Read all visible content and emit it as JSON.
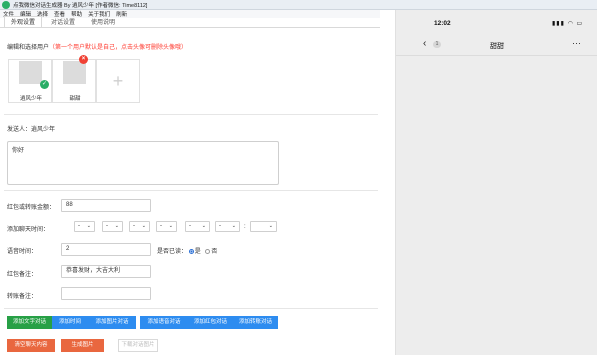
{
  "window": {
    "title": "点我微信对话生成器 By 逍风少年 [作者微信: Time8112]"
  },
  "menu": {
    "items": [
      "文件",
      "编辑",
      "选择",
      "查看",
      "帮助",
      "关于我们",
      "刷新"
    ]
  },
  "tabs": [
    {
      "label": "外观设置",
      "active": true
    },
    {
      "label": "对话设置",
      "active": false
    },
    {
      "label": "使用说明",
      "active": false
    }
  ],
  "users": {
    "hint_prefix": "编辑和选择用户",
    "hint_note": "（第一个用户默认是自己，点击头像可删除头像哦）",
    "list": [
      {
        "name": "逍风少年",
        "badge": "✓"
      },
      {
        "name": "甜甜",
        "badge": "×"
      }
    ],
    "add_symbol": "+"
  },
  "compose": {
    "sender_label": "发送人：逍风少年",
    "message_value": "你好",
    "amount_label": "红包或转账金额：",
    "amount_value": "88",
    "time_label": "添加聊天时间：",
    "time_selects": [
      "-",
      "-",
      "-",
      "-",
      "-",
      "-"
    ],
    "time_separator": ":",
    "voice_label": "语音时间：",
    "voice_value": "2",
    "read_label": "是否已读：",
    "read_yes": "是",
    "read_no": "否",
    "redpacket_note_label": "红包备注：",
    "redpacket_note_value": "恭喜发财，大吉大利",
    "transfer_note_label": "转账备注：",
    "transfer_note_value": ""
  },
  "buttons": {
    "add_text": "添加文字对话",
    "add_time": "添加时间",
    "add_image": "添加图片对话",
    "add_voice": "添加语音对话",
    "add_redpacket": "添加红包对话",
    "add_transfer": "添加转账对话",
    "clear_chat": "清空聊天内容",
    "generate_image": "生成图片",
    "download_image": "下载对话图片"
  },
  "colors": {
    "accent_green": "#27a046",
    "accent_blue": "#2d8cf0",
    "accent_orange": "#e9673f",
    "hint_red": "#ff3b30"
  },
  "phone": {
    "time": "12:02",
    "status_icons": "signal-icon wifi-icon battery-icon",
    "back_symbol": "‹",
    "unread_count": "1",
    "title": "甜甜",
    "more_symbol": "···"
  }
}
